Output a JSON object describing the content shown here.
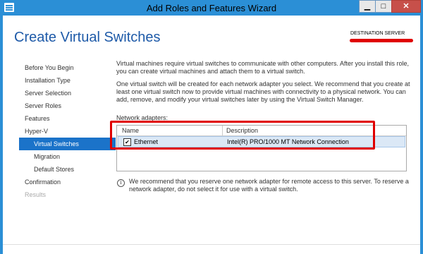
{
  "window": {
    "title": "Add Roles and Features Wizard",
    "controls": {
      "minimize": "▁",
      "maximize": "□",
      "close": "✕"
    }
  },
  "header": {
    "page_title": "Create Virtual Switches",
    "destination_label": "DESTINATION SERVER"
  },
  "nav": {
    "items": [
      {
        "label": "Before You Begin",
        "state": "normal"
      },
      {
        "label": "Installation Type",
        "state": "normal"
      },
      {
        "label": "Server Selection",
        "state": "normal"
      },
      {
        "label": "Server Roles",
        "state": "normal"
      },
      {
        "label": "Features",
        "state": "normal"
      },
      {
        "label": "Hyper-V",
        "state": "normal"
      },
      {
        "label": "Virtual Switches",
        "state": "active"
      },
      {
        "label": "Migration",
        "state": "normal"
      },
      {
        "label": "Default Stores",
        "state": "normal"
      },
      {
        "label": "Confirmation",
        "state": "normal"
      },
      {
        "label": "Results",
        "state": "disabled"
      }
    ]
  },
  "content": {
    "paragraph1": "Virtual machines require virtual switches to communicate with other computers. After you install this role, you can create virtual machines and attach them to a virtual switch.",
    "paragraph2": "One virtual switch will be created for each network adapter you select. We recommend that you create at least one virtual switch now to provide virtual machines with connectivity to a physical network. You can add, remove, and modify your virtual switches later by using the Virtual Switch Manager.",
    "adapters_label": "Network adapters:",
    "table": {
      "columns": [
        "Name",
        "Description"
      ],
      "rows": [
        {
          "checked": true,
          "check_glyph": "✔",
          "name": "Ethernet",
          "description": "Intel(R) PRO/1000 MT Network Connection"
        }
      ]
    },
    "info_glyph": "i",
    "info_text": "We recommend that you reserve one network adapter for remote access to this server. To reserve a network adapter, do not select it for use with a virtual switch."
  },
  "colors": {
    "titlebar": "#2b8fd6",
    "title_text": "#1e5aa8",
    "nav_active": "#1b73c9",
    "highlight_red": "#e00000",
    "row_selected": "#dbe8f6"
  }
}
